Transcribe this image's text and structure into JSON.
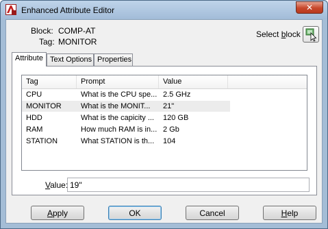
{
  "window": {
    "title": "Enhanced Attribute Editor",
    "close_glyph": "✕"
  },
  "info": {
    "block_label": "Block:",
    "block_value": "COMP-AT",
    "tag_label": "Tag:",
    "tag_value": "MONITOR",
    "select_block_pre": "Select ",
    "select_block_u": "b",
    "select_block_post": "lock",
    "select_block_icon": "select-object-icon"
  },
  "tabs": [
    {
      "label": "Attribute",
      "active": true
    },
    {
      "label": "Text Options",
      "active": false
    },
    {
      "label": "Properties",
      "active": false
    }
  ],
  "table": {
    "columns": [
      "Tag",
      "Prompt",
      "Value"
    ],
    "rows": [
      {
        "tag": "CPU",
        "prompt": "What is the CPU spe...",
        "value": "2.5 GHz",
        "selected": false
      },
      {
        "tag": "MONITOR",
        "prompt": "What is the MONIT...",
        "value": "21\"",
        "selected": true
      },
      {
        "tag": "HDD",
        "prompt": "What is the capicity ...",
        "value": "120 GB",
        "selected": false
      },
      {
        "tag": "RAM",
        "prompt": "How much RAM is in...",
        "value": "2 Gb",
        "selected": false
      },
      {
        "tag": "STATION",
        "prompt": "What STATION is th...",
        "value": "104",
        "selected": false
      }
    ]
  },
  "value_field": {
    "label_u": "V",
    "label_post": "alue:",
    "value": "19\""
  },
  "buttons": {
    "apply_u": "A",
    "apply_post": "pply",
    "ok": "OK",
    "cancel": "Cancel",
    "help_u": "H",
    "help_post": "elp"
  },
  "colors": {
    "frame": "#a4bdd6",
    "close": "#c7472b",
    "selected_row": "#ececec"
  }
}
